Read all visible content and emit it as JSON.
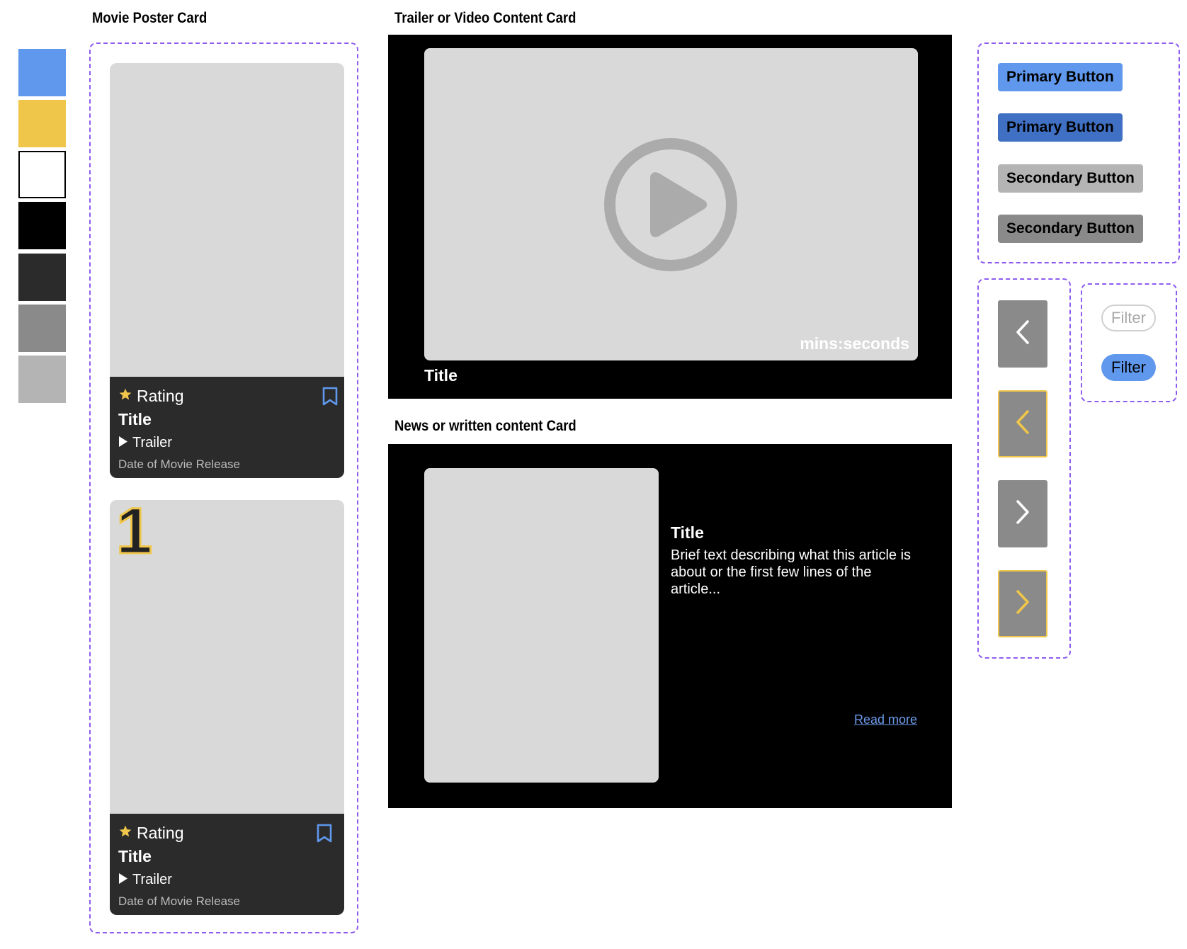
{
  "colors": {
    "accent_blue": "#5f98ec",
    "accent_yellow": "#f0c64a",
    "white": "#ffffff",
    "black": "#000000",
    "dark_gray": "#2b2b2b",
    "mid_gray": "#8a8a8a",
    "light_gray": "#b4b4b4",
    "placeholder_gray": "#d9d9d9",
    "outline_purple": "#8f5cf0"
  },
  "swatches": [
    "#5f98ec",
    "#f0c64a",
    "#ffffff",
    "#000000",
    "#2b2b2b",
    "#8a8a8a",
    "#b4b4b4"
  ],
  "sections": {
    "poster_heading": "Movie Poster Card",
    "video_heading": "Trailer or Video Content Card",
    "news_heading": "News or written content Card"
  },
  "poster_cards": [
    {
      "rating_label": "Rating",
      "title": "Title",
      "trailer_label": "Trailer",
      "release_date": "Date of Movie Release",
      "icons": [
        "star-icon",
        "bookmark-icon",
        "play-icon"
      ]
    },
    {
      "rank": "1",
      "rating_label": "Rating",
      "title": "Title",
      "trailer_label": "Trailer",
      "release_date": "Date of Movie Release",
      "icons": [
        "star-icon",
        "bookmark-icon",
        "play-icon"
      ]
    }
  ],
  "video_card": {
    "duration": "mins:seconds",
    "title": "Title",
    "icon": "play-circle-icon"
  },
  "news_card": {
    "title": "Title",
    "description": "Brief text describing what this article is about or the first few lines of the article...",
    "read_more": "Read more"
  },
  "buttons": {
    "primary": "Primary Button",
    "primary_pressed": "Primary Button",
    "secondary": "Secondary Button",
    "secondary_pressed": "Secondary Button"
  },
  "nav_buttons": [
    {
      "icon": "chevron-left-icon",
      "state": "default"
    },
    {
      "icon": "chevron-left-icon",
      "state": "focused"
    },
    {
      "icon": "chevron-right-icon",
      "state": "default"
    },
    {
      "icon": "chevron-right-icon",
      "state": "focused"
    }
  ],
  "filter_chips": {
    "inactive": "Filter",
    "active": "Filter"
  }
}
